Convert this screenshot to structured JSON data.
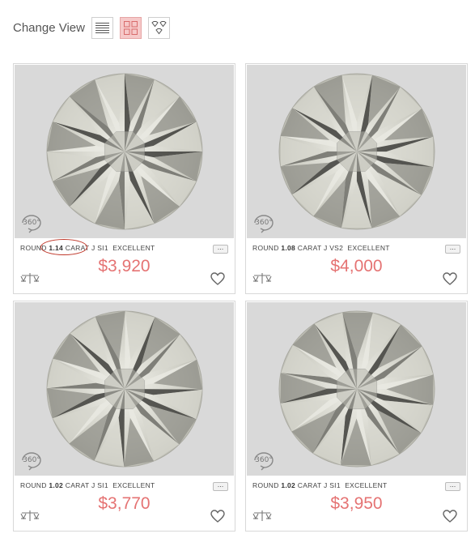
{
  "toolbar": {
    "label": "Change View",
    "views": [
      {
        "name": "list-view",
        "icon": "list-lines-icon",
        "active": false
      },
      {
        "name": "grid-view",
        "icon": "grid-icon",
        "active": true
      },
      {
        "name": "gallery-view",
        "icon": "diamond-gallery-icon",
        "active": false
      }
    ]
  },
  "accent_color": "#e57373",
  "highlight_color": "#c0392b",
  "cards": [
    {
      "shape": "ROUND",
      "carat": "1.14",
      "carat_label": "CARAT",
      "color": "J",
      "clarity": "SI1",
      "cut": "EXCELLENT",
      "price": "$3,920",
      "badge": "360°",
      "highlighted": true
    },
    {
      "shape": "ROUND",
      "carat": "1.08",
      "carat_label": "CARAT",
      "color": "J",
      "clarity": "VS2",
      "cut": "EXCELLENT",
      "price": "$4,000",
      "badge": "360°",
      "highlighted": false
    },
    {
      "shape": "ROUND",
      "carat": "1.02",
      "carat_label": "CARAT",
      "color": "J",
      "clarity": "SI1",
      "cut": "EXCELLENT",
      "price": "$3,770",
      "badge": "360°",
      "highlighted": false
    },
    {
      "shape": "ROUND",
      "carat": "1.02",
      "carat_label": "CARAT",
      "color": "J",
      "clarity": "SI1",
      "cut": "EXCELLENT",
      "price": "$3,950",
      "badge": "360°",
      "highlighted": false
    }
  ]
}
